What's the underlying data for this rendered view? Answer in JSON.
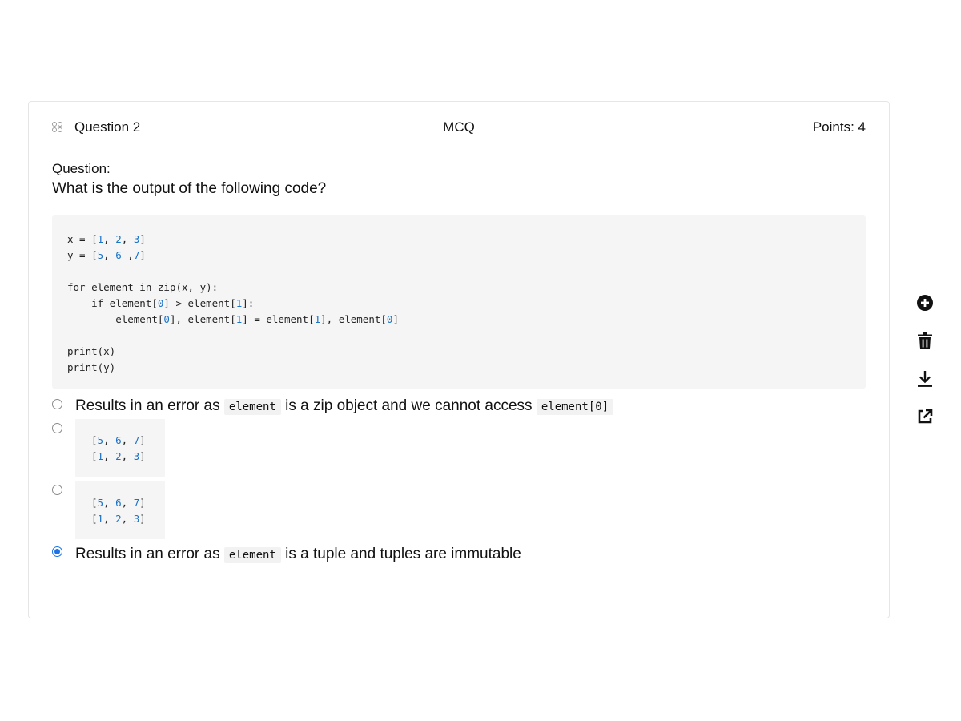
{
  "header": {
    "question_title": "Question 2",
    "question_type": "MCQ",
    "points": "Points: 4",
    "icon": "grid-dots-icon"
  },
  "question": {
    "label": "Question:",
    "text": "What is the output of the following code?",
    "code_lines": [
      "x = [1, 2, 3]",
      "y = [5, 6 ,7]",
      "",
      "for element in zip(x, y):",
      "    if element[0] > element[1]:",
      "        element[0], element[1] = element[1], element[0]",
      "",
      "print(x)",
      "print(y)"
    ]
  },
  "options": [
    {
      "type": "text",
      "selected": false,
      "parts": [
        {
          "text": "Results in an error as "
        },
        {
          "code": "element"
        },
        {
          "text": " is a zip object and we cannot access "
        },
        {
          "code": "element[0]"
        }
      ]
    },
    {
      "type": "code",
      "selected": false,
      "lines": [
        "[5, 6, 7]",
        "[1, 2, 3]"
      ]
    },
    {
      "type": "code",
      "selected": false,
      "lines": [
        "[5, 6, 7]",
        "[1, 2, 3]"
      ]
    },
    {
      "type": "text",
      "selected": true,
      "parts": [
        {
          "text": "Results in an error as "
        },
        {
          "code": "element"
        },
        {
          "text": " is a tuple and tuples are immutable"
        }
      ]
    }
  ],
  "tools": [
    {
      "name": "add-icon"
    },
    {
      "name": "trash-icon"
    },
    {
      "name": "download-icon"
    },
    {
      "name": "external-link-icon"
    }
  ],
  "colors": {
    "accent": "#1a73e8",
    "number": "#1a73c9",
    "code_bg": "#f5f5f5",
    "border": "#e6e6e6"
  }
}
